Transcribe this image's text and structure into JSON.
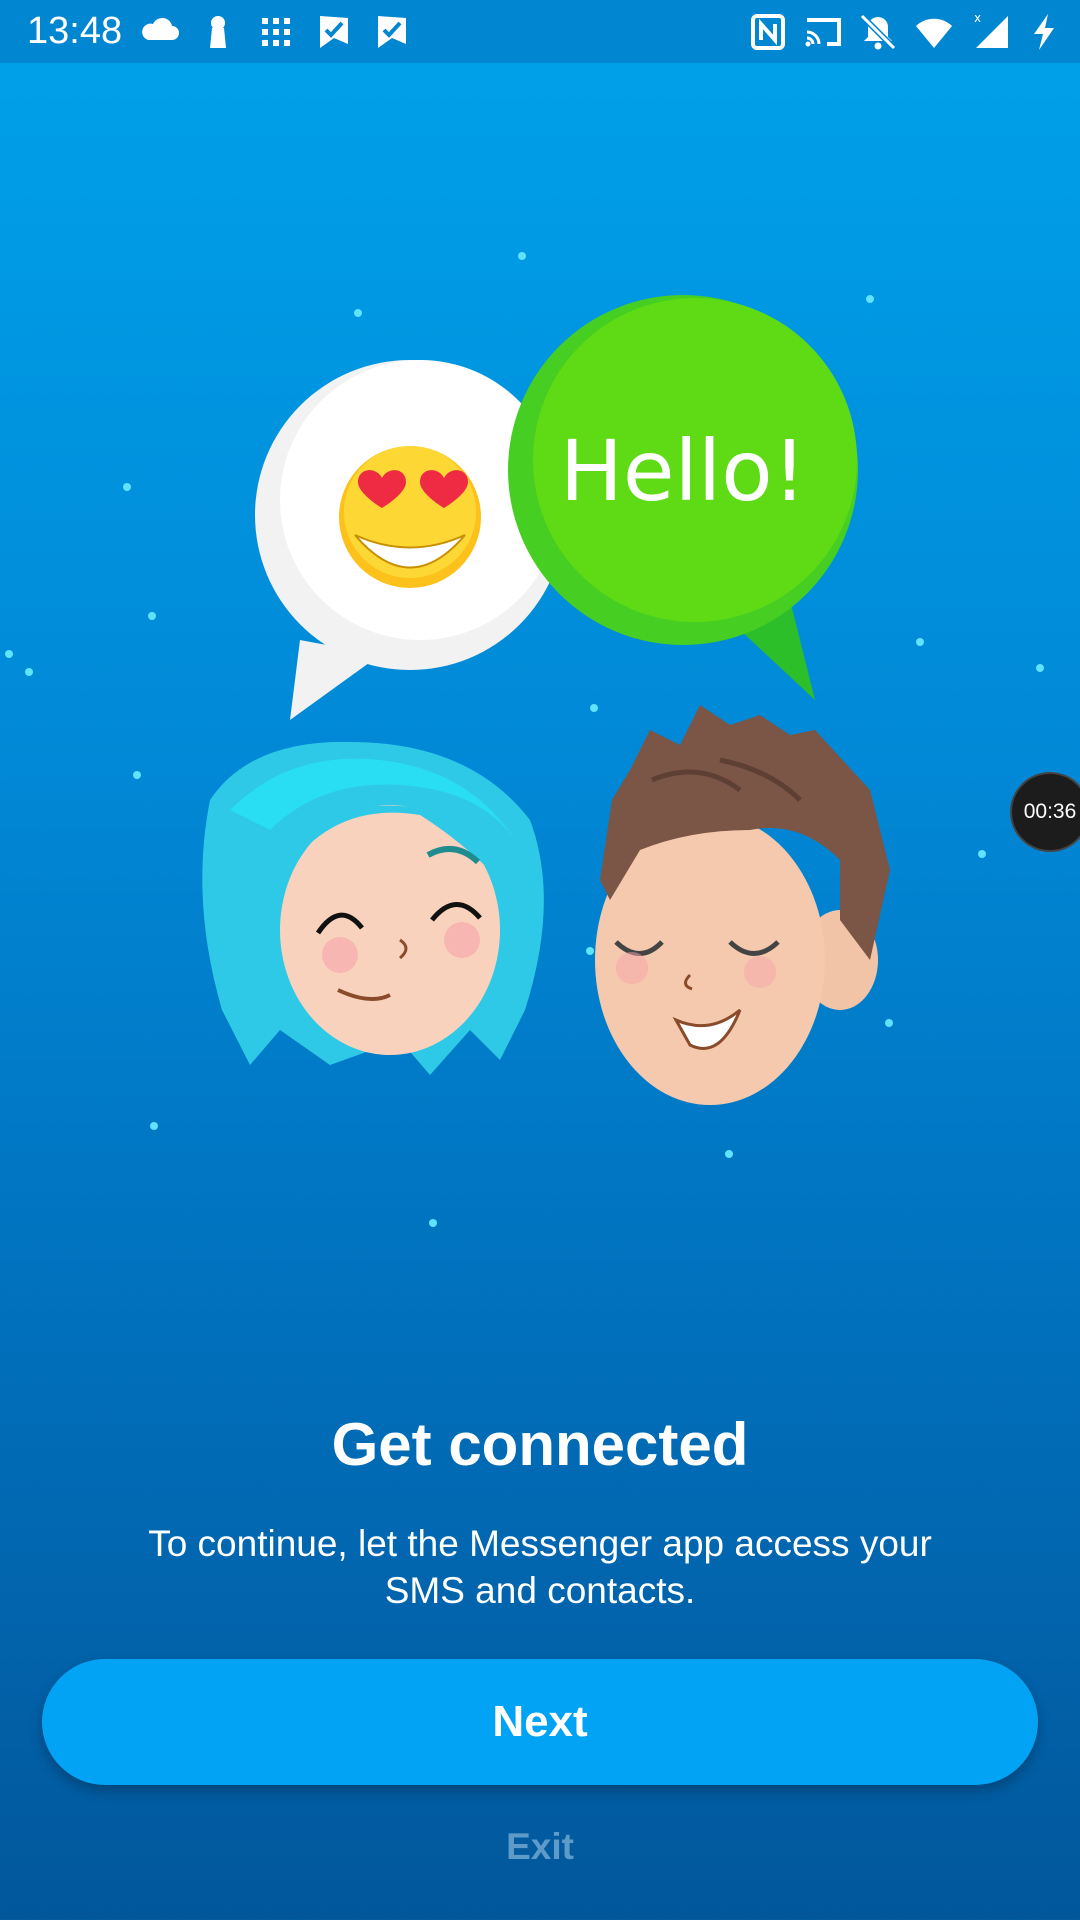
{
  "status_bar": {
    "time": "13:48",
    "left_icons": [
      "cloud-icon",
      "keyhole-icon",
      "app-grid-icon",
      "check-flag-icon",
      "check-flag-icon"
    ],
    "right_icons": [
      "nfc-icon",
      "cast-icon",
      "notifications-off-icon",
      "wifi-icon",
      "signal-icon",
      "charging-icon"
    ]
  },
  "hero": {
    "bubble_text": "Hello!",
    "emoji": "heart-eyes-emoji",
    "characters": [
      "girl-avatar",
      "boy-avatar"
    ]
  },
  "timer_badge": "00:36",
  "main": {
    "title": "Get connected",
    "subtitle": "To continue, let the Messenger app access your SMS and contacts.",
    "next_label": "Next",
    "exit_label": "Exit"
  },
  "colors": {
    "background_top": "#00a2ea",
    "background_bottom": "#02579b",
    "button": "#02a3f4",
    "bubble_green": "#5fdb16",
    "exit_text": "#5f9bc9"
  }
}
